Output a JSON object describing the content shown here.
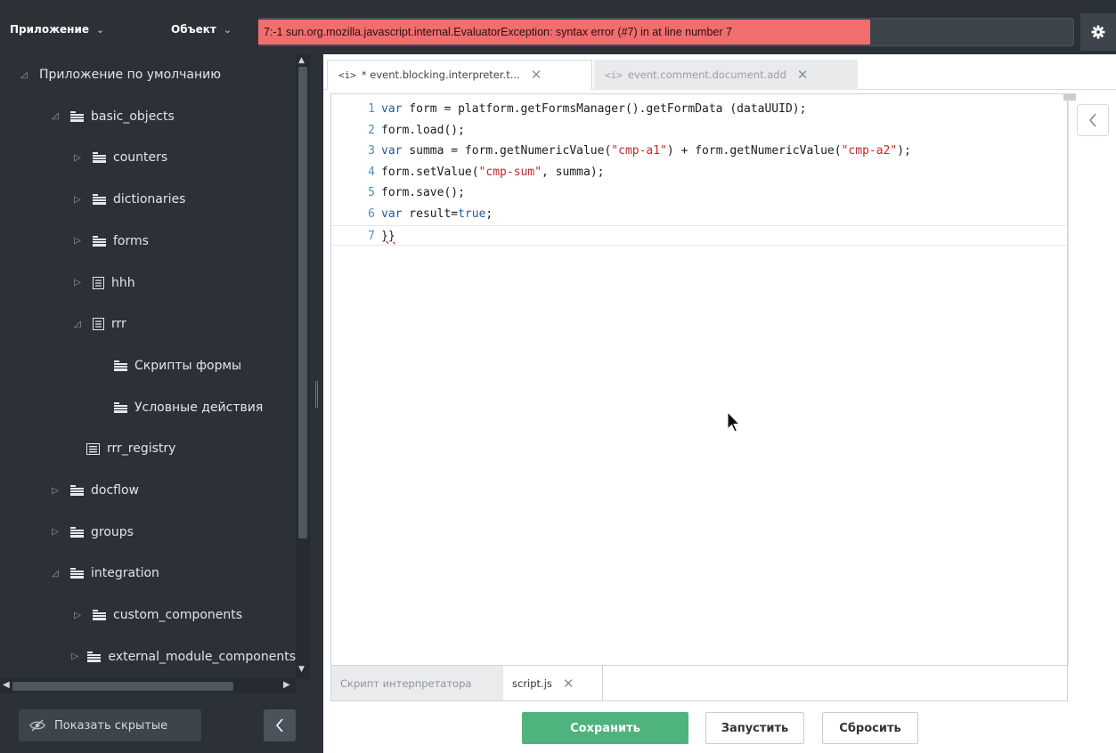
{
  "topbar": {
    "app_menu": "Приложение",
    "object_menu": "Объект",
    "error_message": "7:-1 sun.org.mozilla.javascript.internal.EvaluatorException: syntax error (#7) in at line number 7",
    "settings_icon": "gear-icon"
  },
  "sidebar": {
    "tree": [
      {
        "label": "Приложение по умолчанию",
        "arrow": "◿",
        "icon": "none"
      },
      {
        "label": "basic_objects",
        "arrow": "◿",
        "icon": "folder-icon"
      },
      {
        "label": "counters",
        "arrow": "▷",
        "icon": "folder-icon"
      },
      {
        "label": "dictionaries",
        "arrow": "▷",
        "icon": "folder-icon"
      },
      {
        "label": "forms",
        "arrow": "▷",
        "icon": "folder-icon"
      },
      {
        "label": "hhh",
        "arrow": "▷",
        "icon": "form-icon"
      },
      {
        "label": "rrr",
        "arrow": "◿",
        "icon": "form-icon"
      },
      {
        "label": "Скрипты формы",
        "arrow": "",
        "icon": "folder-icon"
      },
      {
        "label": "Условные действия",
        "arrow": "",
        "icon": "folder-icon"
      },
      {
        "label": "rrr_registry",
        "arrow": "",
        "icon": "registry-icon"
      },
      {
        "label": "docflow",
        "arrow": "▷",
        "icon": "folder-icon"
      },
      {
        "label": "groups",
        "arrow": "▷",
        "icon": "folder-icon"
      },
      {
        "label": "integration",
        "arrow": "◿",
        "icon": "folder-icon"
      },
      {
        "label": "custom_components",
        "arrow": "▷",
        "icon": "folder-icon"
      },
      {
        "label": "external_module_components",
        "arrow": "▷",
        "icon": "folder-icon"
      }
    ],
    "show_hidden_label": "Показать скрытые"
  },
  "tabs": [
    {
      "label": "* event.blocking.interpreter.t...",
      "icon": "<i>",
      "active": true
    },
    {
      "label": "event.comment.document.add",
      "icon": "<i>",
      "active": false
    }
  ],
  "editor": {
    "lines": [
      [
        {
          "t": "var",
          "c": "kw"
        },
        {
          "t": " form = platform.getFormsManager().getFormData (dataUUID);",
          "c": "tx"
        }
      ],
      [
        {
          "t": "form.load();",
          "c": "tx"
        }
      ],
      [
        {
          "t": "var",
          "c": "kw"
        },
        {
          "t": " summa = form.getNumericValue(",
          "c": "tx"
        },
        {
          "t": "\"cmp-a1\"",
          "c": "st"
        },
        {
          "t": ") + form.getNumericValue(",
          "c": "tx"
        },
        {
          "t": "\"cmp-a2\"",
          "c": "st"
        },
        {
          "t": ");",
          "c": "tx"
        }
      ],
      [
        {
          "t": "form.setValue(",
          "c": "tx"
        },
        {
          "t": "\"cmp-sum\"",
          "c": "st"
        },
        {
          "t": ", summa);",
          "c": "tx"
        }
      ],
      [
        {
          "t": "form.save();",
          "c": "tx"
        }
      ],
      [
        {
          "t": "var",
          "c": "kw"
        },
        {
          "t": " result=",
          "c": "tx"
        },
        {
          "t": "true",
          "c": "kw"
        },
        {
          "t": ";",
          "c": "tx"
        }
      ],
      [
        {
          "t": "}}",
          "c": "tx err"
        }
      ]
    ],
    "current_line": 7
  },
  "bottom_tabs": [
    {
      "label": "Скрипт интерпретатора",
      "active": false
    },
    {
      "label": "script.js",
      "active": true
    }
  ],
  "buttons": {
    "save": "Сохранить",
    "run": "Запустить",
    "reset": "Сбросить"
  },
  "colors": {
    "error_bg": "#f26d6d",
    "save_bg": "#4fb37e",
    "sidebar_bg": "#2c3138",
    "keyword": "#1d5aa8",
    "string": "#c0282d"
  }
}
